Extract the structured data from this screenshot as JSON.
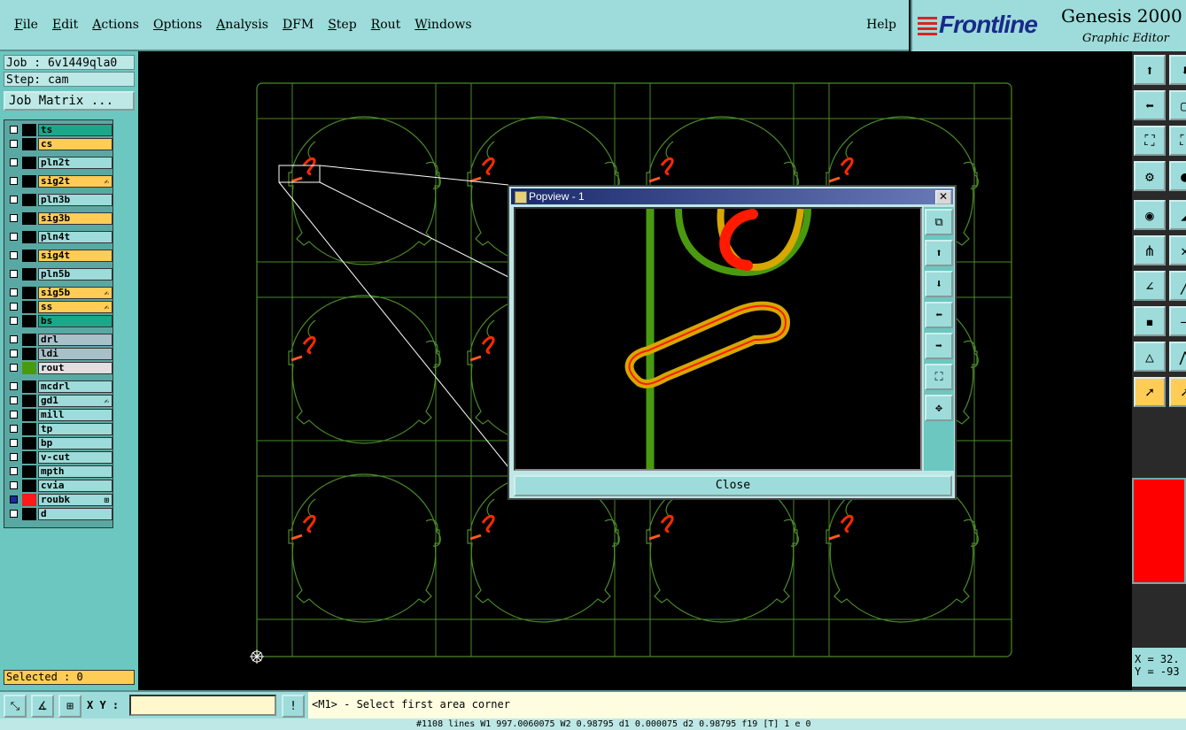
{
  "menubar": {
    "items": [
      "File",
      "Edit",
      "Actions",
      "Options",
      "Analysis",
      "DFM",
      "Step",
      "Rout",
      "Windows"
    ],
    "help": "Help"
  },
  "brand": {
    "logo": "Frontline",
    "product": "Genesis 2000",
    "subtitle": "Graphic Editor"
  },
  "job": {
    "job_label": "Job : 6v1449qla0",
    "step_label": "Step: cam",
    "matrix_button": "Job Matrix ..."
  },
  "layers": [
    {
      "name": "ts",
      "color": "#1aa88a",
      "mark": ""
    },
    {
      "name": "cs",
      "color": "#ffcc55",
      "mark": ""
    },
    {
      "name": "pln2t",
      "color": "#9ddcda",
      "mark": ""
    },
    {
      "name": "sig2t",
      "color": "#ffcc55",
      "mark": "✍"
    },
    {
      "name": "pln3b",
      "color": "#9ddcda",
      "mark": ""
    },
    {
      "name": "sig3b",
      "color": "#ffcc55",
      "mark": ""
    },
    {
      "name": "pln4t",
      "color": "#9ddcda",
      "mark": ""
    },
    {
      "name": "sig4t",
      "color": "#ffcc55",
      "mark": ""
    },
    {
      "name": "pln5b",
      "color": "#9ddcda",
      "mark": ""
    },
    {
      "name": "sig5b",
      "color": "#ffcc55",
      "mark": "✍"
    },
    {
      "name": "ss",
      "color": "#ffcc55",
      "mark": "✍"
    },
    {
      "name": "bs",
      "color": "#1aa88a",
      "mark": ""
    },
    {
      "name": "drl",
      "color": "#a8c0c8",
      "mark": ""
    },
    {
      "name": "ldi",
      "color": "#a8c0c8",
      "mark": ""
    },
    {
      "name": "rout",
      "color": "#e0e0e0",
      "mark": ""
    },
    {
      "name": "mcdrl",
      "color": "#9ddcda",
      "mark": ""
    },
    {
      "name": "gd1",
      "color": "#9ddcda",
      "mark": "✍"
    },
    {
      "name": "mill",
      "color": "#9ddcda",
      "mark": ""
    },
    {
      "name": "tp",
      "color": "#9ddcda",
      "mark": ""
    },
    {
      "name": "bp",
      "color": "#9ddcda",
      "mark": ""
    },
    {
      "name": "v-cut",
      "color": "#9ddcda",
      "mark": ""
    },
    {
      "name": "mpth",
      "color": "#9ddcda",
      "mark": ""
    },
    {
      "name": "cvia",
      "color": "#9ddcda",
      "mark": ""
    },
    {
      "name": "roubk",
      "color": "#9ddcda",
      "mark": "⊞"
    },
    {
      "name": "d",
      "color": "#9ddcda",
      "mark": ""
    }
  ],
  "selected_label": "Selected : 0",
  "popup": {
    "title": "Popview - 1",
    "close_label": "Close",
    "close_x": "✕"
  },
  "coords": {
    "x": "X = 32.",
    "y": "Y = -93"
  },
  "bottom": {
    "xy_label": "X Y :",
    "xy_value": "",
    "prompt": "<M1> - Select first area corner"
  },
  "status_line": "#1108 lines  W1 997.0060075  W2 0.98795  d1 0.000075  d2 0.98795  f19 [T] 1  e 0",
  "colors": {
    "panel": "#9ddcda",
    "outline": "#4a7a2a",
    "route_orange": "#d6a800",
    "route_red": "#ff1a00",
    "rout_green": "#4a9a10"
  }
}
